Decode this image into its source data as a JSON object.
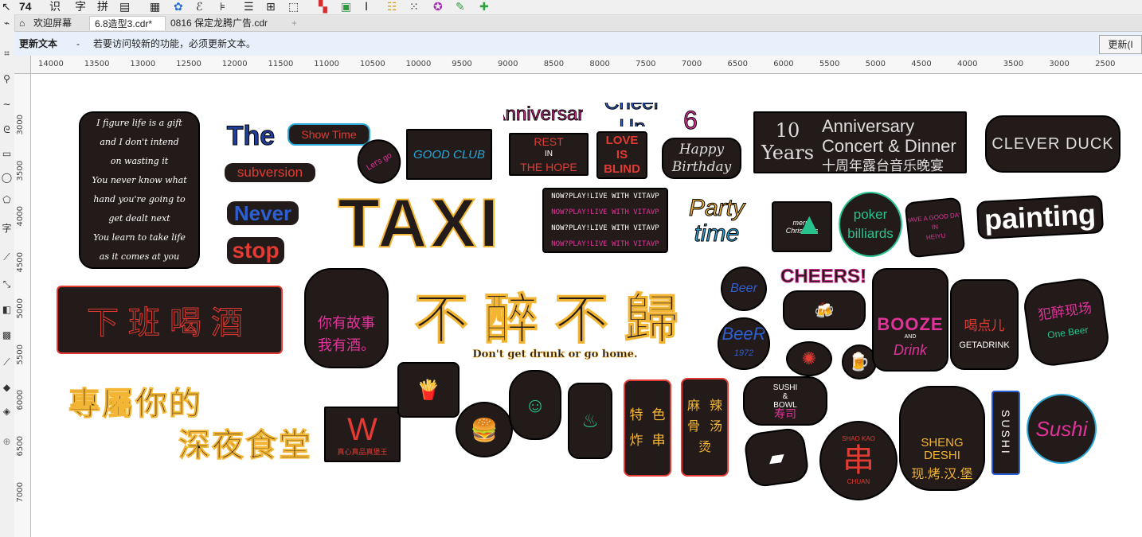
{
  "tabs": [
    {
      "label": "欢迎屏幕"
    },
    {
      "label": "6.8造型3.cdr*"
    },
    {
      "label": "0816 保定龙腾广告.cdr"
    }
  ],
  "tab_add_icon": "+",
  "menu_partial": [
    "识",
    "字",
    "拼"
  ],
  "notice": {
    "title": "更新文本",
    "separator": "-",
    "message": "若要访问较新的功能，必须更新文本。",
    "button": "更新(I"
  },
  "ruler_h_labels": [
    "14000",
    "13500",
    "13000",
    "12500",
    "12000",
    "11500",
    "11000",
    "10500",
    "10000",
    "9500",
    "9000",
    "8500",
    "8000",
    "7500",
    "7000",
    "6500",
    "6000",
    "5500",
    "5000",
    "4500",
    "4000",
    "3500",
    "3000",
    "2500"
  ],
  "ruler_v_labels": [
    "3000",
    "3500",
    "4000",
    "4500",
    "5000",
    "5500",
    "6000",
    "6500",
    "7000"
  ],
  "stickers": {
    "poem": [
      "I figure life is a gift",
      "and I don't intend",
      "on wasting it",
      "You never know what",
      "hand you're going to",
      "get dealt next",
      "You learn to take life",
      "as it comes at you"
    ],
    "the": "The",
    "show_time": "Show Time",
    "subversion": "subversion",
    "lets_go": "Let's go",
    "good_club": "GOOD CLUB",
    "anniversary": "Anniversary",
    "cheer_up": "Cheer Up",
    "six": "6",
    "rest": [
      "REST",
      "IN",
      "THE HOPE"
    ],
    "love": [
      "LOVE",
      "IS",
      "BLIND"
    ],
    "happy": [
      "Happy",
      "Birthday"
    ],
    "years": "10 Years",
    "concert": [
      "Anniversary",
      "Concert & Dinner",
      "十周年露台音乐晚宴"
    ],
    "clever": "CLEVER DUCK",
    "never": "Never",
    "stop": "stop",
    "taxi": "TAXI",
    "nowplay": [
      "NOW?PLAY!LIVE WITH VITAVP",
      "NOW?PLAY!LIVE WITH VITAVP",
      "NOW?PLAY!LIVE WITH VITAVP",
      "NOW?PLAY!LIVE WITH VITAVP"
    ],
    "party": [
      "Party",
      "time"
    ],
    "xmas": [
      "merry",
      "Christmas"
    ],
    "poker": [
      "poker",
      "billiards"
    ],
    "goodday": [
      "HAVE A GOOD DAY",
      "IN",
      "HEIYU"
    ],
    "painting": "painting",
    "xiaban": "下班喝酒",
    "guzhi": [
      "你有故事",
      "我有酒。"
    ],
    "buzui": "不醉不歸",
    "buzui_sub": "Don't get drunk or go home.",
    "beer1": "Beer",
    "cheers": "CHEERS!",
    "beer2": [
      "BeeR",
      "1972"
    ],
    "booze": [
      "BOOZE",
      "AND",
      "Drink"
    ],
    "getdrink": [
      "喝点儿",
      "GETADRINK"
    ],
    "fanzui": [
      "犯醉现场",
      "One Beer"
    ],
    "zhuanshu": "專屬你的",
    "shentang": "深夜食堂",
    "burger_king": "真心真品真堡王",
    "tese": [
      "特",
      "色",
      "炸",
      "串"
    ],
    "mala": [
      "麻",
      "辣",
      "骨",
      "汤",
      "烫"
    ],
    "sushi_bowl": [
      "SUSHI",
      "&",
      "BOWL",
      "寿司"
    ],
    "chuan": "串",
    "shaokao": "SHAO KAO",
    "chuan_sub": "CHUAN",
    "shengdeshi": [
      "SHENG",
      "DESHI",
      "现.烤.汉.堡"
    ],
    "sushi_v": "SUSHI",
    "sushi_c": "Sushi"
  },
  "colors": {
    "accent": "#2aa7d6",
    "neon_red": "#e23b33",
    "neon_yellow": "#f3b534",
    "neon_pink": "#e0339a",
    "neon_blue": "#2c5fd0",
    "neon_green": "#27c28e"
  }
}
